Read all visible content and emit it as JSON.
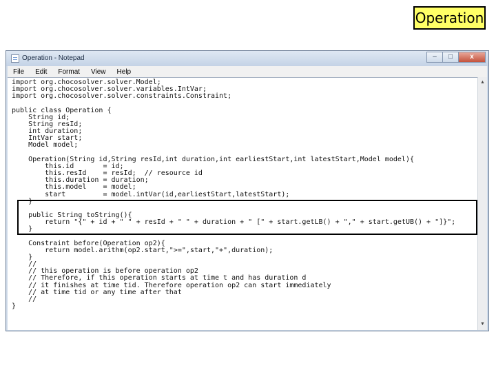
{
  "slide": {
    "title": "Operation"
  },
  "window": {
    "title": "Operation - Notepad",
    "controls": {
      "minimize": "–",
      "maximize": "□",
      "close": "x"
    }
  },
  "menu": [
    "File",
    "Edit",
    "Format",
    "View",
    "Help"
  ],
  "code_lines": [
    "import org.chocosolver.solver.Model;",
    "import org.chocosolver.solver.variables.IntVar;",
    "import org.chocosolver.solver.constraints.Constraint;",
    "",
    "public class Operation {",
    "    String id;",
    "    String resId;",
    "    int duration;",
    "    IntVar start;",
    "    Model model;",
    "",
    "    Operation(String id,String resId,int duration,int earliestStart,int latestStart,Model model){",
    "        this.id       = id;",
    "        this.resId    = resId;  // resource id",
    "        this.duration = duration;",
    "        this.model    = model;",
    "        start         = model.intVar(id,earliestStart,latestStart);",
    "    }",
    "",
    "    public String toString(){",
    "        return \"{\" + id + \" \" + resId + \" \" + duration + \" [\" + start.getLB() + \",\" + start.getUB() + \"]}\";",
    "    }",
    "",
    "    Constraint before(Operation op2){",
    "        return model.arithm(op2.start,\">=\",start,\"+\",duration);",
    "    }",
    "    //",
    "    // this operation is before operation op2",
    "    // Therefore, if this operation starts at time t and has duration d",
    "    // it finishes at time tid. Therefore operation op2 can start immediately",
    "    // at time tid or any time after that",
    "    //",
    "}"
  ]
}
